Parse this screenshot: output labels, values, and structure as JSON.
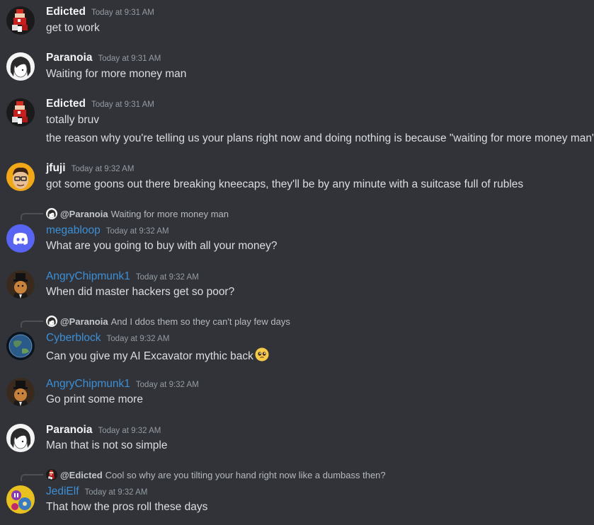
{
  "messages": [
    {
      "author": "Edicted",
      "timestamp": "Today at 9:31 AM",
      "lines": [
        "get to work"
      ],
      "avatar": "edicted-avatar"
    },
    {
      "author": "Paranoia",
      "timestamp": "Today at 9:31 AM",
      "lines": [
        "Waiting for more money man"
      ],
      "avatar": "paranoia-avatar"
    },
    {
      "author": "Edicted",
      "timestamp": "Today at 9:31 AM",
      "lines": [
        "totally bruv",
        "the reason why you're telling us your plans right now and doing nothing is because \"waiting for more money man\""
      ],
      "avatar": "edicted-avatar"
    },
    {
      "author": "jfuji",
      "timestamp": "Today at 9:32 AM",
      "lines": [
        "got some goons out there breaking kneecaps, they'll be by any minute with a suitcase full of rubles"
      ],
      "avatar": "jfuji-avatar"
    },
    {
      "author": "megabloop",
      "timestamp": "Today at 9:32 AM",
      "lines": [
        "What are you going to buy with all your money?"
      ],
      "avatar": "discord-default-avatar",
      "reply": {
        "name": "@Paranoia",
        "text": "Waiting for more money man"
      }
    },
    {
      "author": "AngryChipmunk1",
      "timestamp": "Today at 9:32 AM",
      "lines": [
        "When did master hackers get so poor?"
      ],
      "avatar": "chipmunk-avatar"
    },
    {
      "author": "Cyberblock",
      "timestamp": "Today at 9:32 AM",
      "lines": [
        "Can you give my AI Excavator mythic back"
      ],
      "avatar": "earth-avatar",
      "reply": {
        "name": "@Paranoia",
        "text": "And I ddos them so they can't play few days"
      },
      "emoji": "pleading-face-emoji"
    },
    {
      "author": "AngryChipmunk1",
      "timestamp": "Today at 9:32 AM",
      "lines": [
        "Go print some more"
      ],
      "avatar": "chipmunk-avatar"
    },
    {
      "author": "Paranoia",
      "timestamp": "Today at 9:32 AM",
      "lines": [
        "Man that is not so simple"
      ],
      "avatar": "paranoia-avatar"
    },
    {
      "author": "JediElf",
      "timestamp": "Today at 9:32 AM",
      "lines": [
        "That how the pros roll these days"
      ],
      "avatar": "jedielf-avatar",
      "reply": {
        "name": "@Edicted",
        "text": "Cool so why are you tilting your hand right now like a dumbass then?"
      }
    }
  ],
  "colors": {
    "background": "#313338",
    "username": "#f2f3f5",
    "username_role": "#3d8fd6",
    "timestamp": "#949ba4",
    "text": "#dbdee1"
  }
}
